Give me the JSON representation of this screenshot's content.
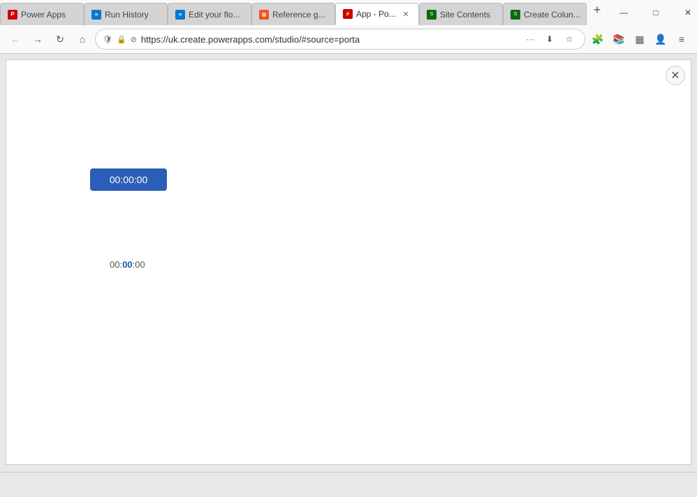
{
  "browser": {
    "url": "https://uk.create.powerapps.com/studio/#source=porta",
    "tabs": [
      {
        "id": "tab-powerapps",
        "label": "Power Apps",
        "favicon": "powerapps",
        "active": false,
        "closeable": false
      },
      {
        "id": "tab-runhistory",
        "label": "Run History",
        "favicon": "flow",
        "active": false,
        "closeable": false
      },
      {
        "id": "tab-editflow",
        "label": "Edit your flo...",
        "favicon": "flow",
        "active": false,
        "closeable": false
      },
      {
        "id": "tab-reference",
        "label": "Reference g...",
        "favicon": "ref",
        "active": false,
        "closeable": false
      },
      {
        "id": "tab-app",
        "label": "App - Po...",
        "favicon": "app",
        "active": true,
        "closeable": true
      },
      {
        "id": "tab-sitecontents",
        "label": "Site Contents",
        "favicon": "sc",
        "active": false,
        "closeable": false
      },
      {
        "id": "tab-createcolumn",
        "label": "Create Colun...",
        "favicon": "cc",
        "active": false,
        "closeable": false
      }
    ],
    "window_controls": {
      "minimize": "—",
      "maximize": "□",
      "close": "✕"
    }
  },
  "navbar": {
    "back_tooltip": "Back",
    "forward_tooltip": "Forward",
    "reload_tooltip": "Reload",
    "home_tooltip": "Home",
    "shield_icon": "🛡",
    "lock_icon": "🔒",
    "more_icon": "···",
    "pocket_icon": "⬇",
    "bookmark_icon": "☆",
    "extensions_icon": "🧩",
    "library_icon": "📚",
    "sidebar_icon": "▦",
    "account_icon": "👤",
    "menu_icon": "≡"
  },
  "app_frame": {
    "close_button_label": "✕",
    "timer_button_label": "00:00:00",
    "timer_text_prefix": "00:",
    "timer_text_highlight": "00",
    "timer_text_suffix": ":00"
  },
  "colors": {
    "timer_button_bg": "#2b5eb8",
    "timer_button_text": "#ffffff",
    "timer_text_highlight": "#1a56b0",
    "timer_text_normal": "#555555"
  }
}
